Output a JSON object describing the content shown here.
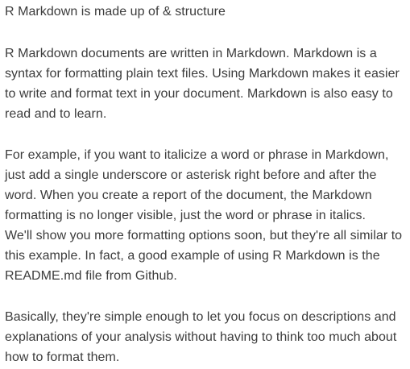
{
  "document": {
    "heading": "R Markdown is made up of & structure",
    "paragraph1": {
      "lines": [
        "R Markdown documents are written in Markdown. Markdown is a",
        "syntax for formatting plain text files. Using Markdown makes it easier",
        "to write and format text in your document. Markdown is also easy to",
        "read and to learn."
      ]
    },
    "paragraph2": {
      "lines": [
        "For example, if you want to italicize a word or phrase in Markdown,",
        "just add a single underscore or asterisk right before and after the",
        "word. When you create a report of the document, the Markdown",
        "formatting is no longer visible, just the word or phrase in italics.",
        "We'll show you more formatting options soon, but they're all similar to",
        "this example. In fact, a good example of using R Markdown is the",
        "README.md file from Github."
      ]
    },
    "paragraph3": {
      "lines": [
        "Basically, they're simple enough to let you focus on descriptions and",
        "explanations of your analysis without having to think too much about",
        "how to format them."
      ]
    }
  }
}
